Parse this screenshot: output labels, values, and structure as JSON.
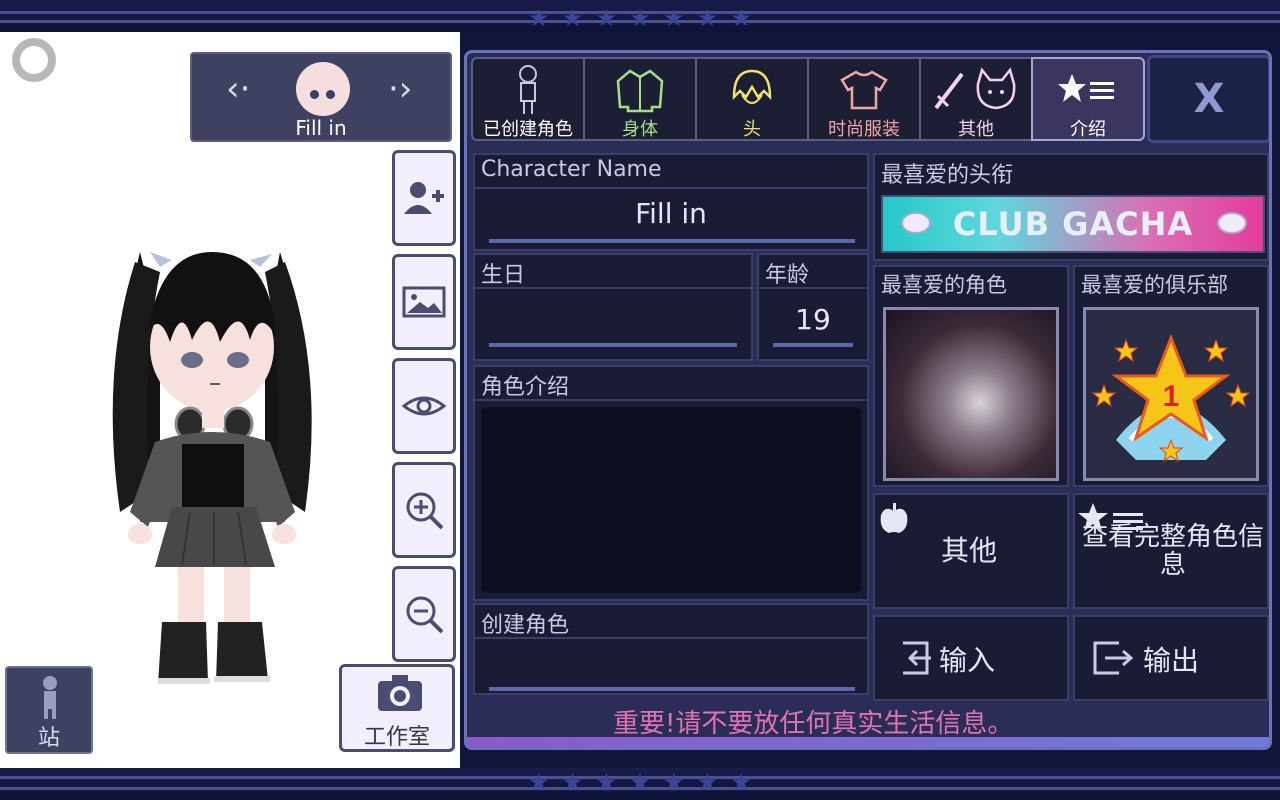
{
  "left": {
    "fill_label": "Fill in",
    "stand_label": "站",
    "studio_label": "工作室"
  },
  "tabs": [
    {
      "label": "已创建角色",
      "color": "#ffffff",
      "icon": "character-silhouette-icon"
    },
    {
      "label": "身体",
      "color": "#a7e087",
      "icon": "jacket-icon"
    },
    {
      "label": "头",
      "color": "#f2e06f",
      "icon": "hair-icon"
    },
    {
      "label": "时尚服装",
      "color": "#f2a5a5",
      "icon": "tshirt-icon"
    },
    {
      "label": "其他",
      "color": "#f5d2f0",
      "icon": "sword-cat-icon"
    },
    {
      "label": "介绍",
      "color": "#ffffff",
      "icon": "star-list-icon"
    }
  ],
  "close_label": "X",
  "profile": {
    "name_header": "Character Name",
    "name_value": "Fill in",
    "birthday_header": "生日",
    "birthday_value": "",
    "age_header": "年龄",
    "age_value": "19",
    "bio_header": "角色介绍",
    "created_header": "创建角色"
  },
  "favorites": {
    "title_header": "最喜爱的头衔",
    "title_value": "CLUB GACHA",
    "character_header": "最喜爱的角色",
    "club_header": "最喜爱的俱乐部",
    "club_badge_number": "1"
  },
  "actions": {
    "other": "其他",
    "view_full": "查看完整角色信息",
    "import": "输入",
    "export": "输出"
  },
  "warning": "重要!请不要放任何真实生活信息。"
}
